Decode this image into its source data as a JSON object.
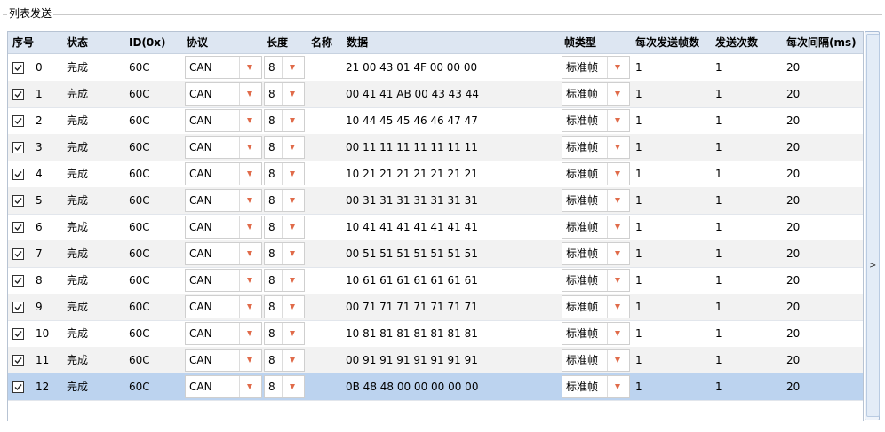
{
  "group_title": "列表发送",
  "columns": {
    "index": "序号",
    "status": "状态",
    "id": "ID(0x)",
    "protocol": "协议",
    "length": "长度",
    "name": "名称",
    "data": "数据",
    "frame_type": "帧类型",
    "frames_per_send": "每次发送帧数",
    "send_count": "发送次数",
    "interval": "每次间隔(ms)"
  },
  "rows": [
    {
      "index": "0",
      "status": "完成",
      "id": "60C",
      "protocol": "CAN",
      "length": "8",
      "name": "",
      "data": "21 00 43 01 4F 00 00 00",
      "frame_type": "标准帧",
      "frames_per_send": "1",
      "send_count": "1",
      "interval": "20"
    },
    {
      "index": "1",
      "status": "完成",
      "id": "60C",
      "protocol": "CAN",
      "length": "8",
      "name": "",
      "data": "00 41 41 AB 00 43 43 44",
      "frame_type": "标准帧",
      "frames_per_send": "1",
      "send_count": "1",
      "interval": "20"
    },
    {
      "index": "2",
      "status": "完成",
      "id": "60C",
      "protocol": "CAN",
      "length": "8",
      "name": "",
      "data": "10 44 45 45 46 46 47 47",
      "frame_type": "标准帧",
      "frames_per_send": "1",
      "send_count": "1",
      "interval": "20"
    },
    {
      "index": "3",
      "status": "完成",
      "id": "60C",
      "protocol": "CAN",
      "length": "8",
      "name": "",
      "data": "00 11 11 11 11 11 11 11",
      "frame_type": "标准帧",
      "frames_per_send": "1",
      "send_count": "1",
      "interval": "20"
    },
    {
      "index": "4",
      "status": "完成",
      "id": "60C",
      "protocol": "CAN",
      "length": "8",
      "name": "",
      "data": "10 21 21 21 21 21 21 21",
      "frame_type": "标准帧",
      "frames_per_send": "1",
      "send_count": "1",
      "interval": "20"
    },
    {
      "index": "5",
      "status": "完成",
      "id": "60C",
      "protocol": "CAN",
      "length": "8",
      "name": "",
      "data": "00 31 31 31 31 31 31 31",
      "frame_type": "标准帧",
      "frames_per_send": "1",
      "send_count": "1",
      "interval": "20"
    },
    {
      "index": "6",
      "status": "完成",
      "id": "60C",
      "protocol": "CAN",
      "length": "8",
      "name": "",
      "data": "10 41 41 41 41 41 41 41",
      "frame_type": "标准帧",
      "frames_per_send": "1",
      "send_count": "1",
      "interval": "20"
    },
    {
      "index": "7",
      "status": "完成",
      "id": "60C",
      "protocol": "CAN",
      "length": "8",
      "name": "",
      "data": "00 51 51 51 51 51 51 51",
      "frame_type": "标准帧",
      "frames_per_send": "1",
      "send_count": "1",
      "interval": "20"
    },
    {
      "index": "8",
      "status": "完成",
      "id": "60C",
      "protocol": "CAN",
      "length": "8",
      "name": "",
      "data": "10 61 61 61 61 61 61 61",
      "frame_type": "标准帧",
      "frames_per_send": "1",
      "send_count": "1",
      "interval": "20"
    },
    {
      "index": "9",
      "status": "完成",
      "id": "60C",
      "protocol": "CAN",
      "length": "8",
      "name": "",
      "data": "00 71 71 71 71 71 71 71",
      "frame_type": "标准帧",
      "frames_per_send": "1",
      "send_count": "1",
      "interval": "20"
    },
    {
      "index": "10",
      "status": "完成",
      "id": "60C",
      "protocol": "CAN",
      "length": "8",
      "name": "",
      "data": "10 81 81 81 81 81 81 81",
      "frame_type": "标准帧",
      "frames_per_send": "1",
      "send_count": "1",
      "interval": "20"
    },
    {
      "index": "11",
      "status": "完成",
      "id": "60C",
      "protocol": "CAN",
      "length": "8",
      "name": "",
      "data": "00 91 91 91 91 91 91 91",
      "frame_type": "标准帧",
      "frames_per_send": "1",
      "send_count": "1",
      "interval": "20"
    },
    {
      "index": "12",
      "status": "完成",
      "id": "60C",
      "protocol": "CAN",
      "length": "8",
      "name": "",
      "data": "0B 48 48 00 00 00 00 00",
      "frame_type": "标准帧",
      "frames_per_send": "1",
      "send_count": "1",
      "interval": "20"
    }
  ],
  "selected_row": 12,
  "scrollbar": {
    "glyph": ">"
  },
  "icons": {
    "checkbox": "checkmark-icon",
    "dropdown": "triangle-down-icon"
  },
  "colors": {
    "header_bg": "#dde6f2",
    "selected_row": "#bcd3ef",
    "alt_row": "#f2f2f2",
    "arrow": "#e06b4a"
  }
}
